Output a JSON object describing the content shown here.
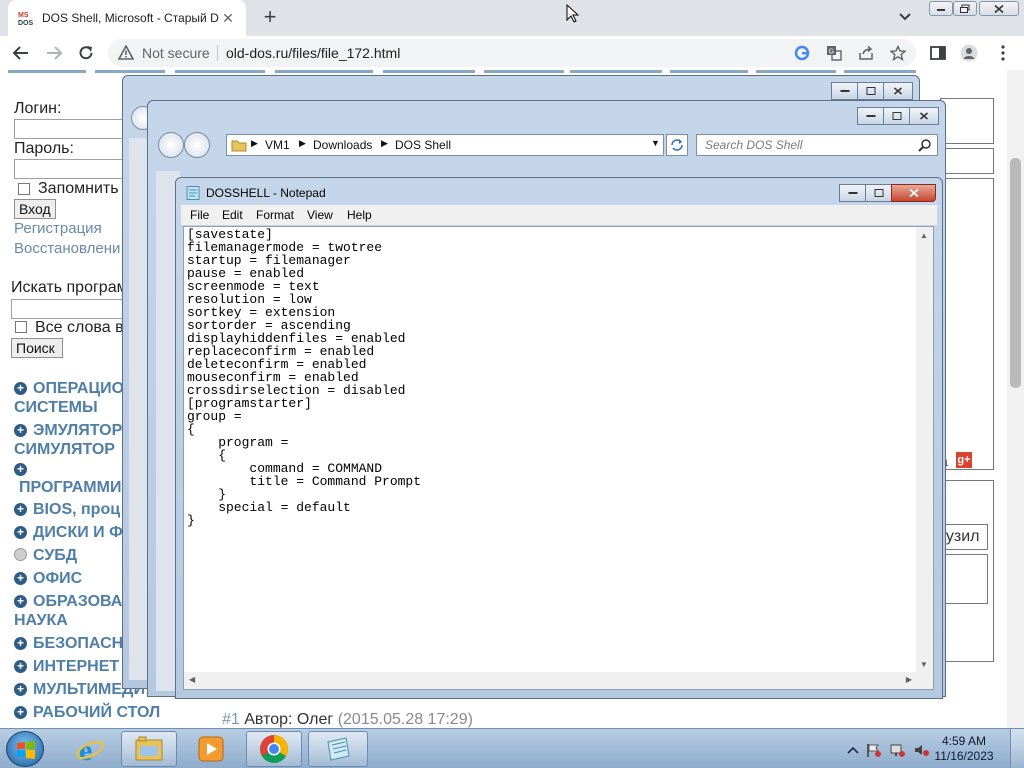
{
  "browser": {
    "tab_title": "DOS Shell, Microsoft - Старый D",
    "tab_close": "✕",
    "new_tab": "+",
    "security_label": "Not secure",
    "url": "old-dos.ru/files/file_172.html"
  },
  "webpage": {
    "login_label": "Логин:",
    "password_label": "Пароль:",
    "remember_label": "Запомнить",
    "login_button": "Вход",
    "register_link": "Регистрация",
    "restore_link": "Восстановлени",
    "search_label": "Искать програм",
    "all_words_label": "Все слова в",
    "search_button": "Поиск",
    "menu": [
      {
        "label": "ОПЕРАЦИО",
        "label2": "СИСТЕМЫ",
        "marker": "plus"
      },
      {
        "label": "ЭМУЛЯТОР",
        "label2": "СИМУЛЯТОР",
        "marker": "plus"
      },
      {
        "label": "",
        "label2": "ПРОГРАММИ",
        "marker": "plus"
      },
      {
        "label": "BIOS, проц",
        "marker": "plus"
      },
      {
        "label": "ДИСКИ И Ф",
        "marker": "plus"
      },
      {
        "label": "СУБД",
        "marker": "dot"
      },
      {
        "label": "ОФИС",
        "marker": "plus"
      },
      {
        "label": "ОБРАЗОВА",
        "label2": "НАУКА",
        "marker": "plus"
      },
      {
        "label": "БЕЗОПАСН",
        "marker": "plus"
      },
      {
        "label": "ИНТЕРНЕТ",
        "marker": "plus"
      },
      {
        "label": "МУЛЬТИМЕДИ",
        "marker": "plus"
      },
      {
        "label": "РАБОЧИЙ СТОЛ",
        "marker": "plus"
      }
    ],
    "side_fragment": "а",
    "gplus": "g+",
    "uzil_fragment": "ёузил",
    "comment_number": "#1",
    "comment_author": "Автор: Олег",
    "comment_date": "(2015.05.28 17:29)"
  },
  "explorer": {
    "path": [
      "VM1",
      "Downloads",
      "DOS Shell"
    ],
    "search_placeholder": "Search DOS Shell"
  },
  "notepad": {
    "title": "DOSSHELL - Notepad",
    "menus": [
      "File",
      "Edit",
      "Format",
      "View",
      "Help"
    ],
    "content": "[savestate]\nfilemanagermode = twotree\nstartup = filemanager\npause = enabled\nscreenmode = text\nresolution = low\nsortkey = extension\nsortorder = ascending\ndisplayhiddenfiles = enabled\nreplaceconfirm = enabled\ndeleteconfirm = enabled\nmouseconfirm = enabled\ncrossdirselection = disabled\n[programstarter]\ngroup =\n{\n    program =\n    {\n        command = COMMAND\n        title = Command Prompt\n    }\n    special = default\n}"
  },
  "taskbar": {
    "time": "4:59 AM",
    "date": "11/16/2023",
    "apps": [
      "internet-explorer",
      "windows-explorer",
      "media-player",
      "chrome",
      "notepad"
    ]
  }
}
